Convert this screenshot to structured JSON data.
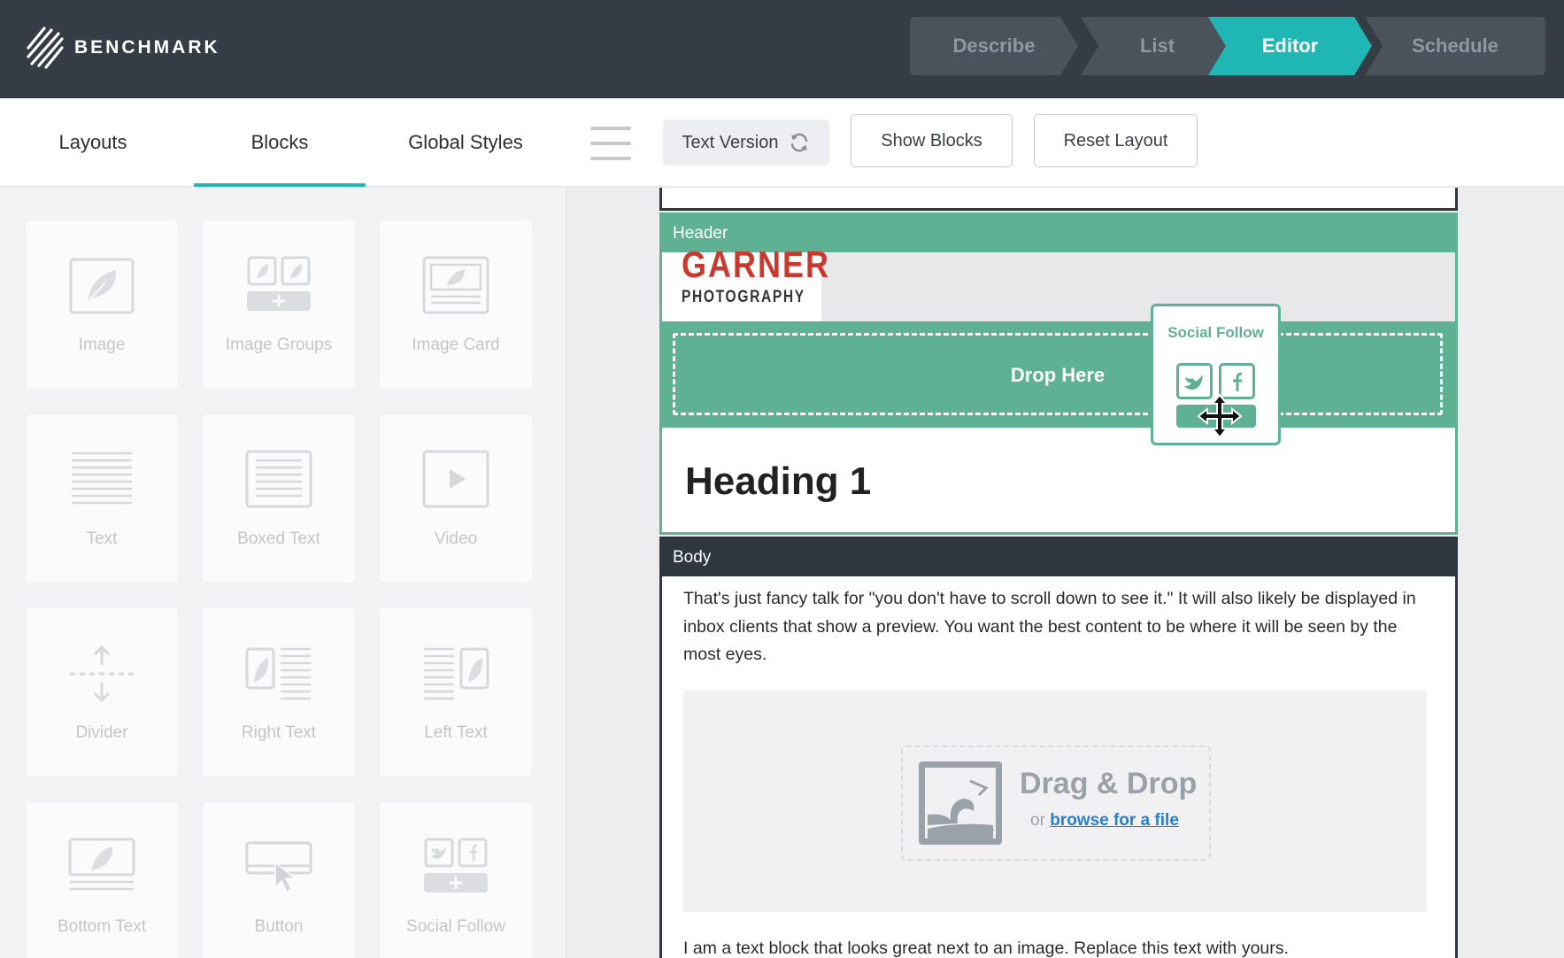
{
  "app": {
    "logo_text": "BENCHMARK"
  },
  "steps": [
    {
      "label": "Describe",
      "active": false
    },
    {
      "label": "List",
      "active": false
    },
    {
      "label": "Editor",
      "active": true
    },
    {
      "label": "Schedule",
      "active": false
    }
  ],
  "colors": {
    "topbar": "#353c45",
    "accent": "#20b6b3",
    "header_green": "#5fb194",
    "body_dark": "#2f3640",
    "link": "#2a7fc9",
    "brand_red": "#c93a2e"
  },
  "tabs": [
    {
      "label": "Layouts",
      "active": false
    },
    {
      "label": "Blocks",
      "active": true
    },
    {
      "label": "Global Styles",
      "active": false
    }
  ],
  "toolbar": {
    "text_version_label": "Text Version",
    "show_blocks_label": "Show Blocks",
    "reset_layout_label": "Reset Layout"
  },
  "blocks": [
    {
      "label": "Image",
      "icon": "image-icon"
    },
    {
      "label": "Image Groups",
      "icon": "image-groups-icon"
    },
    {
      "label": "Image Card",
      "icon": "image-card-icon"
    },
    {
      "label": "Text",
      "icon": "text-icon"
    },
    {
      "label": "Boxed Text",
      "icon": "boxed-text-icon"
    },
    {
      "label": "Video",
      "icon": "video-icon"
    },
    {
      "label": "Divider",
      "icon": "divider-icon"
    },
    {
      "label": "Right Text",
      "icon": "right-text-icon"
    },
    {
      "label": "Left Text",
      "icon": "left-text-icon"
    },
    {
      "label": "Bottom Text",
      "icon": "bottom-text-icon"
    },
    {
      "label": "Button",
      "icon": "button-icon"
    },
    {
      "label": "Social Follow",
      "icon": "social-follow-icon"
    }
  ],
  "canvas": {
    "header": {
      "label": "Header",
      "logo_line1": "GARNER",
      "logo_line2": "PHOTOGRAPHY",
      "drop_text": "Drop Here",
      "heading": "Heading 1"
    },
    "body": {
      "label": "Body",
      "paragraph": "That's just fancy talk for \"you don't have to scroll down to see it.\" It will also likely be displayed in inbox clients that show a preview. You want the best content to be where it will be seen by the most eyes.",
      "drag_title": "Drag & Drop",
      "drag_or": "or",
      "drag_link": "browse for a file",
      "paragraph2": "I am a text block that looks great next to an image. Replace this text with yours."
    }
  },
  "dragging": {
    "title": "Social Follow",
    "icons": [
      "twitter-icon",
      "facebook-icon"
    ]
  }
}
